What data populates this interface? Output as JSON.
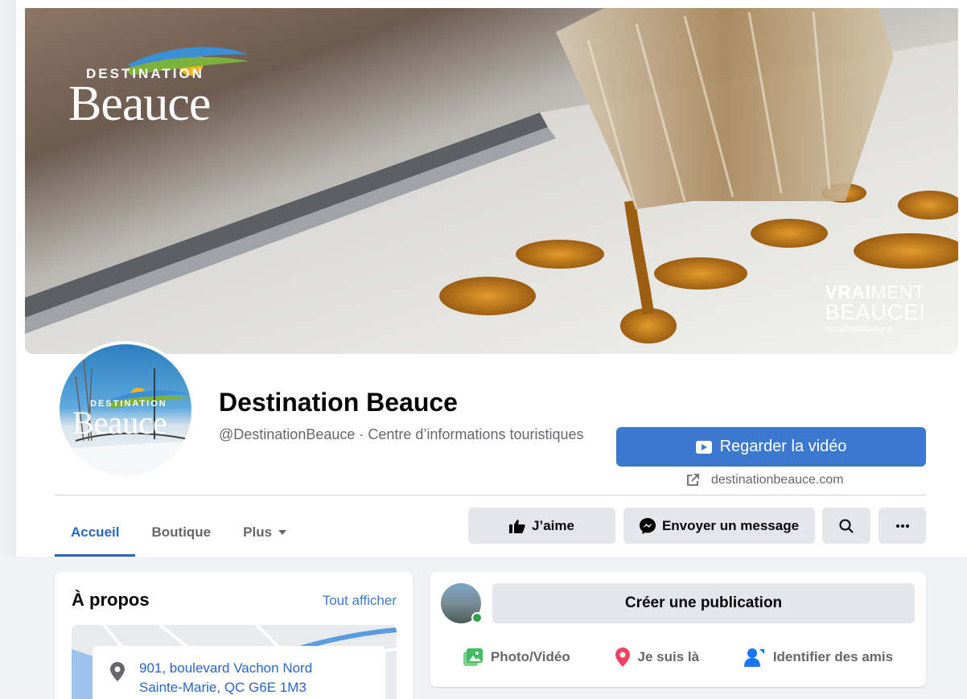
{
  "cover": {
    "logo_top": "DESTINATION",
    "logo_main": "Beauce",
    "slogan_bold": "VRAI",
    "slogan_rest": "MENT",
    "slogan_line2": "BEAUCE!",
    "hashtag": "#vraimentbeauce"
  },
  "avatar": {
    "logo_top": "DESTINATION",
    "logo_main": "Beauce"
  },
  "page": {
    "name": "Destination Beauce",
    "handle_category": "@DestinationBeauce · Centre d’informations touristiques"
  },
  "header_actions": {
    "watch_video": "Regarder la vidéo",
    "website": "destinationbeauce.com",
    "like": "J’aime",
    "message": "Envoyer un message"
  },
  "tabs": [
    {
      "label": "Accueil"
    },
    {
      "label": "Boutique"
    },
    {
      "label": "Plus"
    }
  ],
  "about": {
    "title": "À propos",
    "see_all": "Tout afficher",
    "address_line1": "901, boulevard Vachon Nord",
    "address_line2": "Sainte-Marie, QC G6E 1M3"
  },
  "composer": {
    "create_post": "Créer une publication",
    "photo_video": "Photo/Vidéo",
    "checkin": "Je suis là",
    "tag_friends": "Identifier des amis"
  },
  "colors": {
    "primary_blue": "#3b79cf",
    "link_blue": "#2b66c7",
    "button_gray": "#e4e6eb",
    "page_bg": "#f0f2f5",
    "online_green": "#31a24c"
  }
}
